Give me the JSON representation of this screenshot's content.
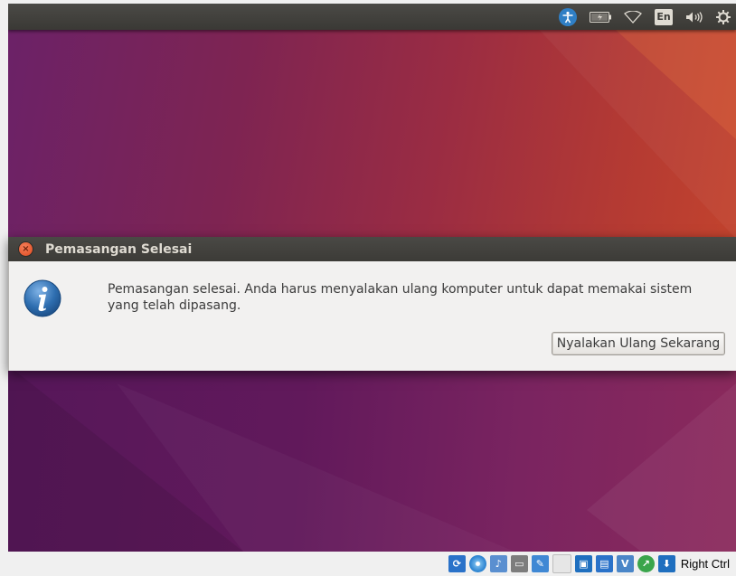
{
  "top_panel": {
    "icons": [
      "accessibility-icon",
      "battery-icon",
      "wifi-icon",
      "keyboard-layout-indicator",
      "volume-icon",
      "settings-gear-icon"
    ],
    "keyboard_layout": "En"
  },
  "dialog": {
    "title": "Pemasangan Selesai",
    "icon": "info-icon",
    "message": "Pemasangan selesai. Anda harus menyalakan ulang komputer untuk dapat memakai sistem yang telah dipasang.",
    "button_label": "Nyalakan Ulang Sekarang"
  },
  "vbox_status_bar": {
    "icons": [
      "hard-disk-icon",
      "optical-drive-icon",
      "audio-icon",
      "network-icon",
      "usb-icon",
      "shared-folders-icon",
      "display-icon",
      "video-capture-icon",
      "cpu-icon",
      "mouse-integration-icon",
      "keyboard-capture-icon"
    ],
    "host_key_label": "Right Ctrl",
    "colors": {
      "primary": "#2a72c9",
      "accent": "#3aa54b"
    }
  },
  "colors": {
    "wallpaper_left": "#6b2268",
    "wallpaper_right": "#c8472b",
    "panel": "#3c3b37",
    "close_button": "#e0491f",
    "dialog_bg": "#f2f1f0",
    "info_blue": "#2e6eb0"
  }
}
